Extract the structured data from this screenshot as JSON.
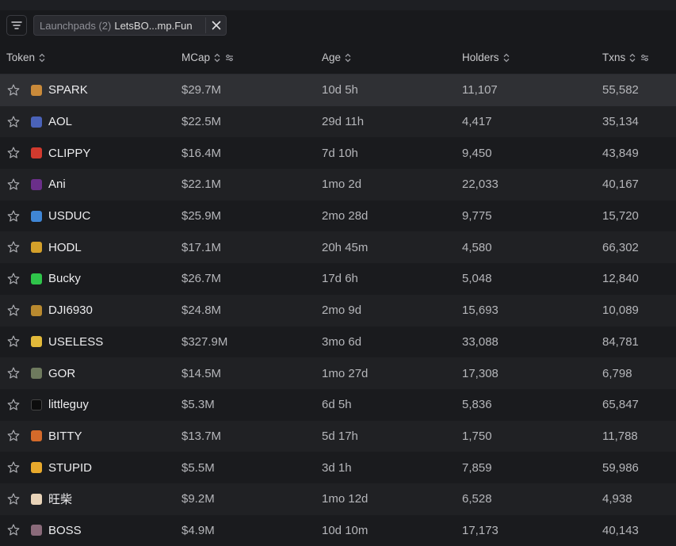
{
  "filters": {
    "filter_button_icon": "filter-lines-icon",
    "chip": {
      "label": "Launchpads (2)",
      "value": "LetsBO...mp.Fun",
      "close_icon": "close-icon"
    }
  },
  "columns": {
    "token": "Token",
    "mcap": "MCap",
    "age": "Age",
    "holders": "Holders",
    "txns": "Txns"
  },
  "rows": [
    {
      "name": "SPARK",
      "icon_color": "#c98a3a",
      "mcap": "$29.7M",
      "age": "10d 5h",
      "holders": "11,107",
      "txns": "55,582",
      "selected": true
    },
    {
      "name": "AOL",
      "icon_color": "#4a62b8",
      "mcap": "$22.5M",
      "age": "29d 11h",
      "holders": "4,417",
      "txns": "35,134"
    },
    {
      "name": "CLIPPY",
      "icon_color": "#d13a2e",
      "mcap": "$16.4M",
      "age": "7d 10h",
      "holders": "9,450",
      "txns": "43,849"
    },
    {
      "name": "Ani",
      "icon_color": "#6b2f8a",
      "mcap": "$22.1M",
      "age": "1mo 2d",
      "holders": "22,033",
      "txns": "40,167"
    },
    {
      "name": "USDUC",
      "icon_color": "#3f86d6",
      "mcap": "$25.9M",
      "age": "2mo 28d",
      "holders": "9,775",
      "txns": "15,720"
    },
    {
      "name": "HODL",
      "icon_color": "#d4a02a",
      "mcap": "$17.1M",
      "age": "20h 45m",
      "holders": "4,580",
      "txns": "66,302"
    },
    {
      "name": "Bucky",
      "icon_color": "#2fc44a",
      "mcap": "$26.7M",
      "age": "17d 6h",
      "holders": "5,048",
      "txns": "12,840"
    },
    {
      "name": "DJI6930",
      "icon_color": "#b8892f",
      "mcap": "$24.8M",
      "age": "2mo 9d",
      "holders": "15,693",
      "txns": "10,089"
    },
    {
      "name": "USELESS",
      "icon_color": "#e2b93a",
      "mcap": "$327.9M",
      "age": "3mo 6d",
      "holders": "33,088",
      "txns": "84,781"
    },
    {
      "name": "GOR",
      "icon_color": "#6e7a5e",
      "mcap": "$14.5M",
      "age": "1mo 27d",
      "holders": "17,308",
      "txns": "6,798"
    },
    {
      "name": "littleguy",
      "icon_color": "#0d0d0d",
      "mcap": "$5.3M",
      "age": "6d 5h",
      "holders": "5,836",
      "txns": "65,847"
    },
    {
      "name": "BITTY",
      "icon_color": "#d46a2a",
      "mcap": "$13.7M",
      "age": "5d 17h",
      "holders": "1,750",
      "txns": "11,788"
    },
    {
      "name": "STUPID",
      "icon_color": "#e8a92c",
      "mcap": "$5.5M",
      "age": "3d 1h",
      "holders": "7,859",
      "txns": "59,986"
    },
    {
      "name": "旺柴",
      "icon_color": "#e8d3b8",
      "mcap": "$9.2M",
      "age": "1mo 12d",
      "holders": "6,528",
      "txns": "4,938"
    },
    {
      "name": "BOSS",
      "icon_color": "#8a6a7a",
      "mcap": "$4.9M",
      "age": "10d 10m",
      "holders": "17,173",
      "txns": "40,143"
    }
  ]
}
